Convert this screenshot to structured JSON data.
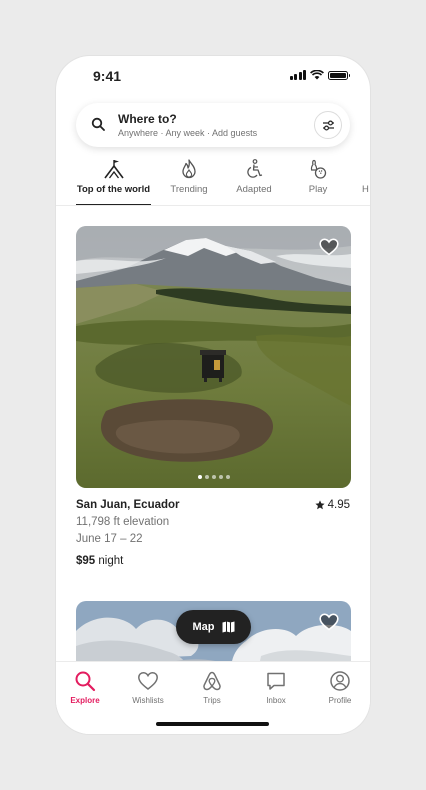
{
  "status": {
    "time": "9:41"
  },
  "search": {
    "title": "Where to?",
    "subtitle": "Anywhere · Any week · Add guests"
  },
  "categories": [
    {
      "label": "Top of the world",
      "icon": "summit-flag-icon",
      "active": true
    },
    {
      "label": "Trending",
      "icon": "flame-icon"
    },
    {
      "label": "Adapted",
      "icon": "wheelchair-icon"
    },
    {
      "label": "Play",
      "icon": "bowling-icon"
    },
    {
      "label": "H"
    }
  ],
  "listing": {
    "location": "San Juan, Ecuador",
    "rating": "4.95",
    "line1": "11,798 ft elevation",
    "line2": "June 17 – 22",
    "price": "$95",
    "price_unit": "night",
    "photo_index": 1,
    "photo_count": 5
  },
  "map_button": {
    "label": "Map"
  },
  "tabs": [
    {
      "label": "Explore",
      "icon": "search-icon",
      "active": true
    },
    {
      "label": "Wishlists",
      "icon": "heart-outline-icon"
    },
    {
      "label": "Trips",
      "icon": "airbnb-logo-icon"
    },
    {
      "label": "Inbox",
      "icon": "message-icon"
    },
    {
      "label": "Profile",
      "icon": "profile-icon"
    }
  ],
  "colors": {
    "accent": "#e31c5f",
    "text": "#222222",
    "muted": "#717171"
  }
}
